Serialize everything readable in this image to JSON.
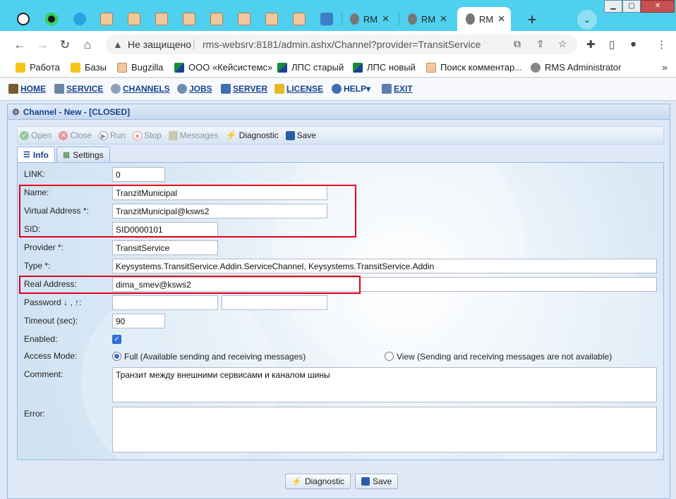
{
  "browser": {
    "tabs": [
      {
        "icon": "arrow-circle-icon",
        "title": ""
      },
      {
        "icon": "green-gear-icon",
        "title": ""
      },
      {
        "icon": "telegram-icon",
        "title": ""
      },
      {
        "icon": "pig-icon",
        "title": ""
      },
      {
        "icon": "pig-icon",
        "title": ""
      },
      {
        "icon": "pig-icon",
        "title": ""
      },
      {
        "icon": "pig-icon",
        "title": ""
      },
      {
        "icon": "pig-icon",
        "title": ""
      },
      {
        "icon": "pig-icon",
        "title": ""
      },
      {
        "icon": "pig-icon",
        "title": ""
      },
      {
        "icon": "pig-icon",
        "title": ""
      },
      {
        "icon": "mail-icon",
        "title": ""
      },
      {
        "icon": "gear-icon",
        "title": "RM"
      },
      {
        "icon": "gear-icon",
        "title": "RM"
      },
      {
        "icon": "gear-icon",
        "title": "RM"
      }
    ],
    "address": {
      "security_label": "Не защищено",
      "url": "rms-websrv:8181/admin.ashx/Channel?provider=TransitService"
    },
    "bookmarks": [
      {
        "label": "Работа",
        "icon": "folder"
      },
      {
        "label": "Базы",
        "icon": "folder"
      },
      {
        "label": "Bugzilla",
        "icon": "pig"
      },
      {
        "label": "ООО «Кейсистемс»",
        "icon": "ks"
      },
      {
        "label": "ЛПС старый",
        "icon": "ks"
      },
      {
        "label": "ЛПС новый",
        "icon": "ks"
      },
      {
        "label": "Поиск комментар...",
        "icon": "pig"
      },
      {
        "label": "RMS Administrator",
        "icon": "gear"
      }
    ],
    "bookmarks_more": "»"
  },
  "app": {
    "menu": {
      "home": "HOME",
      "service": "SERVICE",
      "channels": "CHANNELS",
      "jobs": "JOBS",
      "server": "SERVER",
      "license": "LICENSE",
      "help": "HELP▾",
      "exit": "EXIT"
    },
    "panel_title": "Channel - New - [CLOSED]",
    "actions": {
      "open": "Open",
      "close": "Close",
      "run": "Run",
      "stop": "Stop",
      "messages": "Messages",
      "diagnostic": "Diagnostic",
      "save": "Save"
    },
    "tabs": {
      "info": "Info",
      "settings": "Settings"
    },
    "form": {
      "link_label": "LINK:",
      "link_value": "0",
      "name_label": "Name:",
      "name_value": "TranzitMunicipal",
      "vaddr_label": "Virtual Address *:",
      "vaddr_value": "TranzitMunicipal@ksws2",
      "sid_label": "SID:",
      "sid_value": "SID0000101",
      "provider_label": "Provider *:",
      "provider_value": "TransitService",
      "type_label": "Type *:",
      "type_value": "Keysystems.TransitService.Addin.ServiceChannel, Keysystems.TransitService.Addin",
      "raddr_label": "Real Address:",
      "raddr_value": "dima_smev@ksws2",
      "password_label": "Password ↓ , ↑:",
      "password_value1": "",
      "password_value2": "",
      "timeout_label": "Timeout (sec):",
      "timeout_value": "90",
      "enabled_label": "Enabled:",
      "enabled_checked": true,
      "access_label": "Access Mode:",
      "access_full": "Full (Available sending and receiving messages)",
      "access_view": "View (Sending and receiving messages are not available)",
      "access_selected": "full",
      "comment_label": "Comment:",
      "comment_value": "Транзит между внешними сервисами и каналом шины",
      "error_label": "Error:",
      "error_value": ""
    },
    "bottom": {
      "diagnostic": "Diagnostic",
      "save": "Save"
    }
  }
}
